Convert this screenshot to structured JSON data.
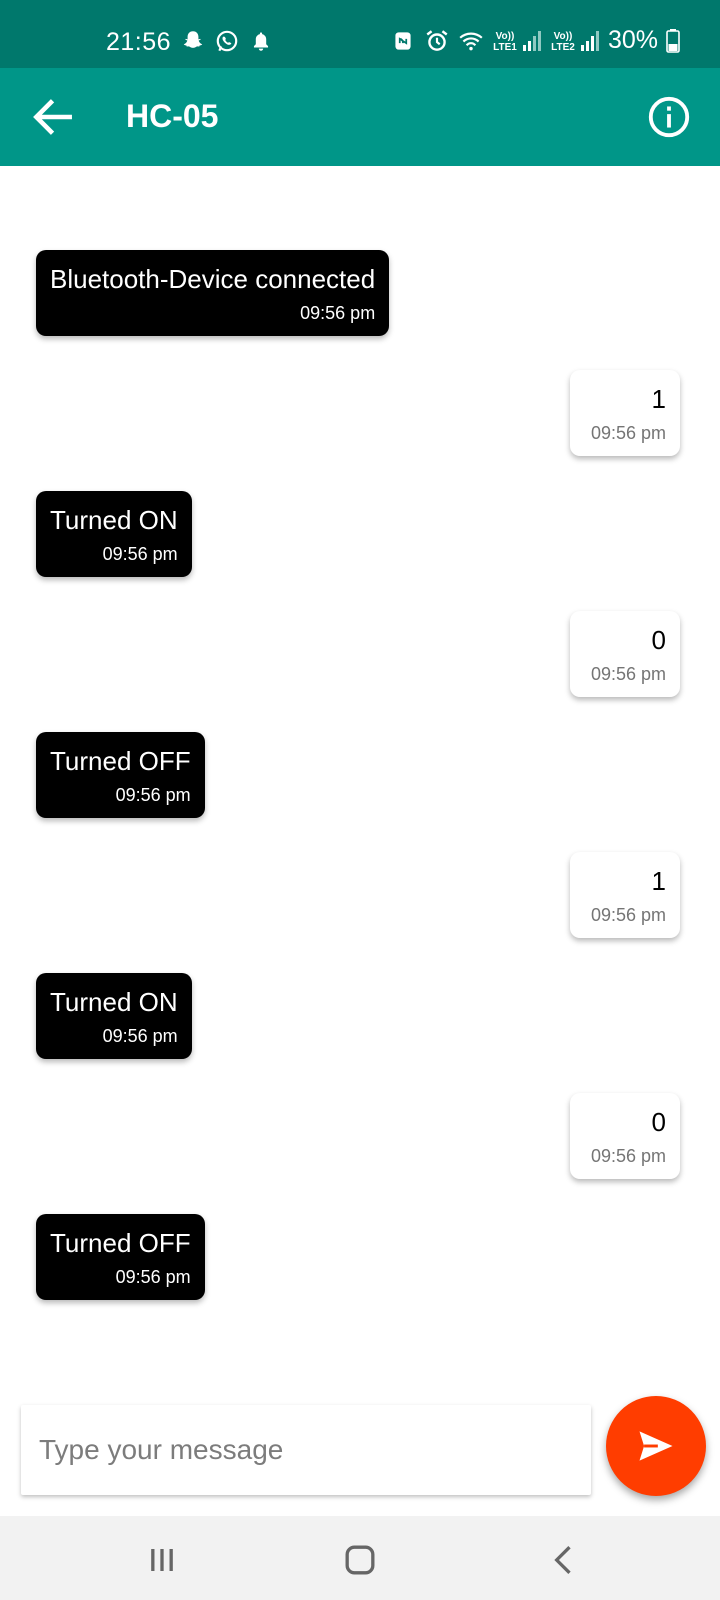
{
  "status_bar": {
    "time": "21:56",
    "notification_icons": [
      "snapchat-icon",
      "whatsapp-icon",
      "bell-icon"
    ],
    "system_icons": [
      "nfc-icon",
      "alarm-icon",
      "wifi-icon",
      "signal-lte1-icon",
      "signal-lte2-icon"
    ],
    "sim1_label": "Vo)) LTE1",
    "sim2_label": "Vo)) LTE2",
    "battery": "30%"
  },
  "app_bar": {
    "title": "HC-05",
    "back_icon": "arrow-left-icon",
    "info_icon": "info-icon",
    "color": "#009688"
  },
  "messages": [
    {
      "direction": "in",
      "text": "Bluetooth-Device connected",
      "time": "09:56 pm"
    },
    {
      "direction": "out",
      "text": "1",
      "time": "09:56 pm"
    },
    {
      "direction": "in",
      "text": "Turned ON",
      "time": "09:56 pm"
    },
    {
      "direction": "out",
      "text": "0",
      "time": "09:56 pm"
    },
    {
      "direction": "in",
      "text": "Turned OFF",
      "time": "09:56 pm"
    },
    {
      "direction": "out",
      "text": "1",
      "time": "09:56 pm"
    },
    {
      "direction": "in",
      "text": "Turned ON",
      "time": "09:56 pm"
    },
    {
      "direction": "out",
      "text": "0",
      "time": "09:56 pm"
    },
    {
      "direction": "in",
      "text": "Turned OFF",
      "time": "09:56 pm"
    }
  ],
  "composer": {
    "placeholder": "Type your message",
    "value": "",
    "send_icon": "send-icon",
    "send_color": "#ff3d00"
  },
  "nav_bar": {
    "recents_icon": "recents-icon",
    "home_icon": "home-icon",
    "back_icon": "chevron-left-icon"
  }
}
